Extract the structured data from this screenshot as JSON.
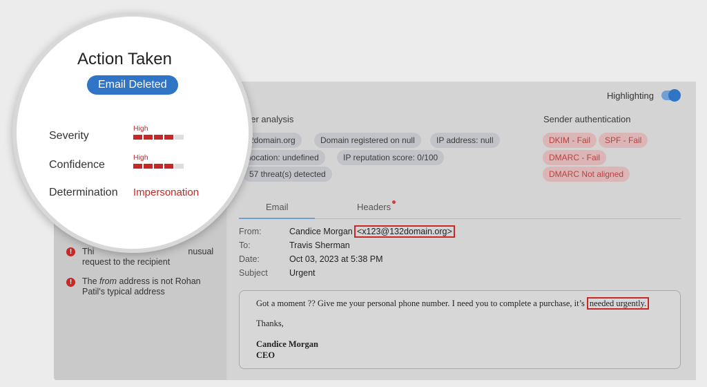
{
  "highlighting": {
    "label": "Highlighting",
    "enabled": true
  },
  "sender_analysis": {
    "title": "der analysis",
    "chips": [
      "2domain.org",
      "Domain registered on null",
      "IP address: null",
      "location: undefined",
      "IP reputation score: 0/100",
      "57 threat(s) detected"
    ]
  },
  "sender_authentication": {
    "title": "Sender authentication",
    "chips": [
      "DKIM - Fail",
      "SPF - Fail",
      "DMARC - Fail",
      "DMARC Not aligned"
    ]
  },
  "tabs": {
    "email": "Email",
    "headers": "Headers"
  },
  "email_meta": {
    "from_label": "From:",
    "from_name": "Candice Morgan",
    "from_address": "<x123@132domain.org>",
    "to_label": "To:",
    "to_value": "Travis Sherman",
    "date_label": "Date:",
    "date_value": "Oct 03, 2023 at 5:38 PM",
    "subject_label": "Subject",
    "subject_value": "Urgent"
  },
  "email_body": {
    "text": "Got a moment ?? Give me your personal phone number. I need you to complete a purchase, it’s",
    "highlight": "needed urgently.",
    "closing": "Thanks,",
    "signature_name": "Candice Morgan",
    "signature_title": "CEO"
  },
  "reasons": {
    "r1_part1": "Thi",
    "r1_part2": "nusual",
    "r1_line2": "request to the recipient",
    "r2_prefix": "The ",
    "r2_italic": "from",
    "r2_suffix": " address is not Rohan",
    "r2_line2": "Patil's typical address"
  },
  "action": {
    "title": "Action Taken",
    "status": "Email Deleted",
    "severity_label": "Severity",
    "severity_level": "High",
    "severity_fraction": 0.8,
    "confidence_label": "Confidence",
    "confidence_level": "High",
    "confidence_fraction": 0.8,
    "determination_label": "Determination",
    "determination_value": "Impersonation"
  },
  "colors": {
    "accent": "#2f74c5",
    "danger": "#c62828"
  }
}
